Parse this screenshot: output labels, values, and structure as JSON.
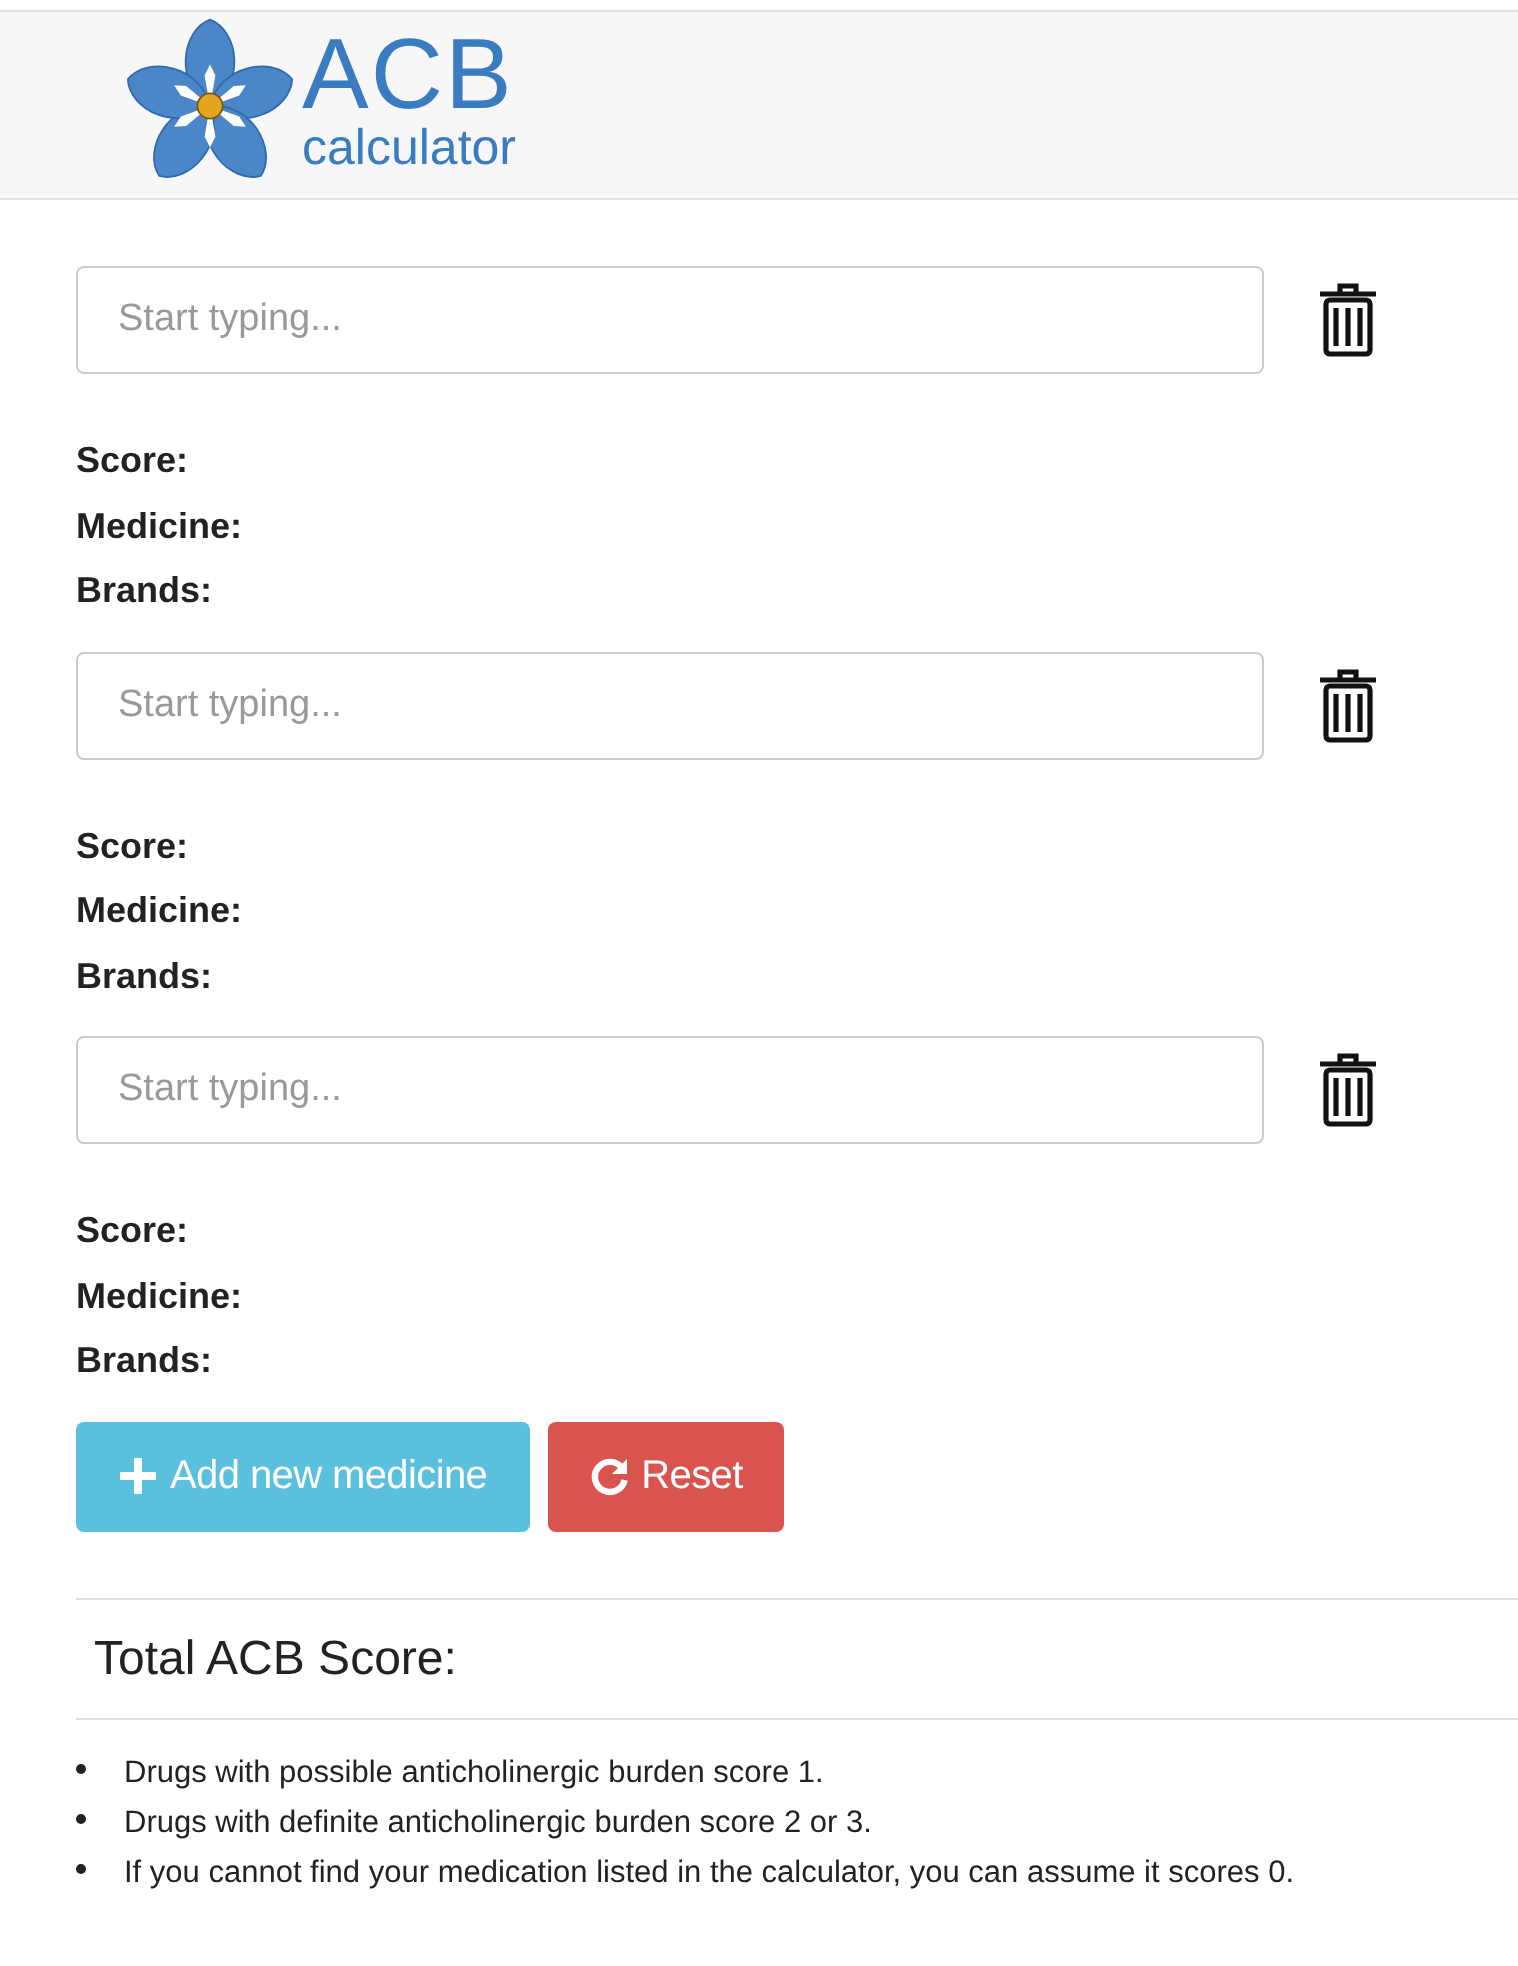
{
  "header": {
    "logo_title": "ACB",
    "logo_subtitle": "calculator"
  },
  "medicines": [
    {
      "placeholder": "Start typing...",
      "score_label": "Score:",
      "medicine_label": "Medicine:",
      "brands_label": "Brands:"
    },
    {
      "placeholder": "Start typing...",
      "score_label": "Score:",
      "medicine_label": "Medicine:",
      "brands_label": "Brands:"
    },
    {
      "placeholder": "Start typing...",
      "score_label": "Score:",
      "medicine_label": "Medicine:",
      "brands_label": "Brands:"
    }
  ],
  "buttons": [
    {
      "kind": "add",
      "label": "Add new medicine"
    },
    {
      "kind": "reset",
      "label": "Reset"
    }
  ],
  "total_label": "Total ACB Score:",
  "notes": [
    "Drugs with possible anticholinergic burden score 1.",
    "Drugs with definite anticholinergic burden score 2 or 3.",
    "If you cannot find your medication listed in the calculator, you can assume it scores 0."
  ]
}
